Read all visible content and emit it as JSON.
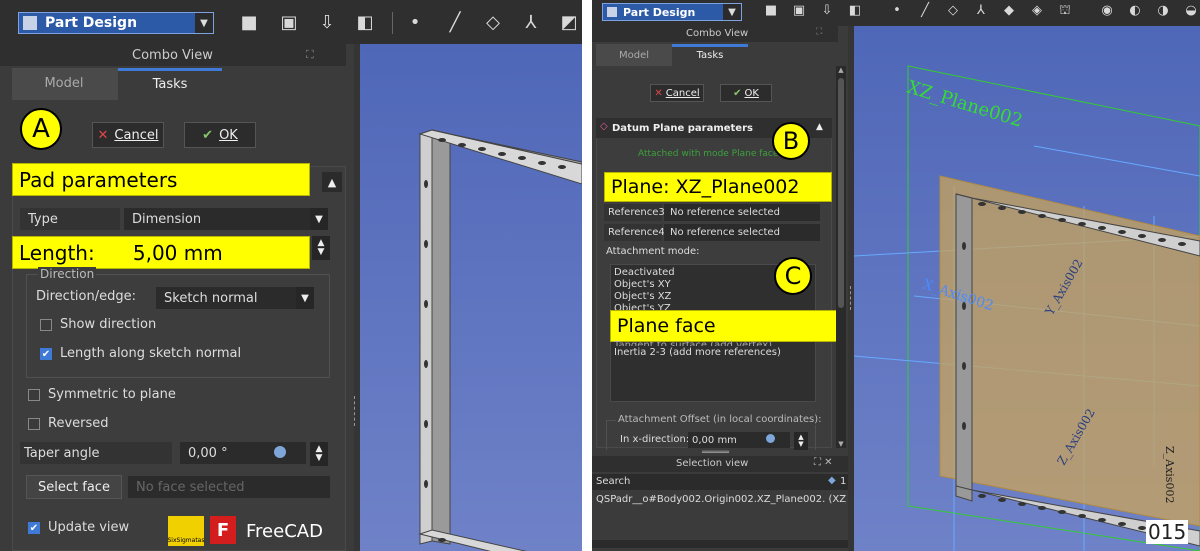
{
  "left": {
    "workbench": "Part Design",
    "combo_view_title": "Combo View",
    "tabs": [
      "Model",
      "Tasks"
    ],
    "cancel_label": "Cancel",
    "ok_label": "OK",
    "pad_parameters_label": "Pad parameters",
    "type_label": "Type",
    "type_value": "Dimension",
    "length_label": "Length:      5,00 mm",
    "direction_group": "Direction",
    "direction_edge_label": "Direction/edge:",
    "direction_edge_value": "Sketch normal",
    "show_direction_label": "Show direction",
    "length_along_label": "Length along sketch normal",
    "symmetric_label": "Symmetric to plane",
    "reversed_label": "Reversed",
    "taper_label": "Taper angle",
    "taper_value": "0,00 °",
    "select_face_label": "Select face",
    "select_face_placeholder": "No face selected",
    "update_view_label": "Update view",
    "badge": "A",
    "logo_six": "SixSigmatas",
    "logo_freecad": "FreeCAD"
  },
  "right": {
    "workbench": "Part Design",
    "combo_view_title": "Combo View",
    "tabs": [
      "Model",
      "Tasks"
    ],
    "cancel_label": "Cancel",
    "ok_label": "OK",
    "datum_title": "Datum Plane parameters",
    "attached_text": "Attached with mode Plane face",
    "plane_label": "Plane: XZ_Plane002",
    "ref3_label": "Reference3",
    "ref3_value": "No reference selected",
    "ref4_label": "Reference4",
    "ref4_value": "No reference selected",
    "attachment_mode_label": "Attachment mode:",
    "modes": [
      "Deactivated",
      "Object's XY",
      "Object's XZ",
      "Object's YZ"
    ],
    "plane_face_label": "Plane face",
    "mode_tangent": "Tangent to surface (add vertex)",
    "mode_inertia": "Inertia 2-3 (add more references)",
    "offset_label": "Attachment Offset (in local coordinates):",
    "x_dir_label": "In x-direction:",
    "x_dir_value": "0,00 mm",
    "selection_view_title": "Selection view",
    "search_label": "Search",
    "search_count": "1",
    "selection_item": "QSPadr__o#Body002.Origin002.XZ_Plane002. (XZ_Pla",
    "badge_b": "B",
    "badge_c": "C",
    "view_plane_label": "XZ_Plane002",
    "view_axis_label_1": "X_Axis002",
    "view_axis_label_2": "Y_Axis002",
    "view_axis_label_3": "Z_Axis002",
    "view_axis_label_4": "Z_Axis002",
    "page_number": "015"
  },
  "colors": {
    "highlight": "#ffff00",
    "accent": "#3f7ad6",
    "panel": "#3b3b3b"
  }
}
